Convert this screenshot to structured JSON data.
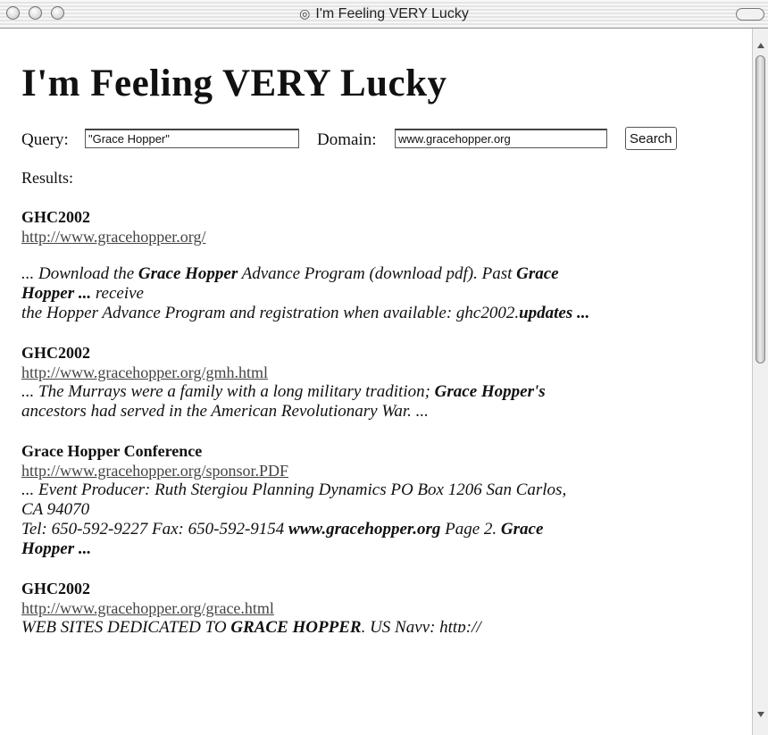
{
  "window": {
    "title": "I'm Feeling VERY Lucky",
    "title_icon": "compass-icon"
  },
  "page": {
    "heading": "I'm Feeling VERY Lucky",
    "query_label": "Query:",
    "query_value": "\"Grace Hopper\"",
    "domain_label": "Domain:",
    "domain_value": "www.gracehopper.org",
    "search_button": "Search",
    "results_label": "Results:"
  },
  "results": [
    {
      "title": "GHC2002",
      "url": "http://www.gracehopper.org/",
      "lines": [
        [
          [
            "",
            "... Download the "
          ],
          [
            "b",
            "Grace Hopper"
          ],
          [
            "",
            " Advance Program (download pdf). Past "
          ],
          [
            "b",
            "Grace"
          ]
        ],
        [
          [
            "b",
            "Hopper ..."
          ],
          [
            "",
            " receive"
          ]
        ],
        [
          [
            "",
            "the Hopper Advance Program and registration when available: ghc2002."
          ],
          [
            "b",
            "updates ..."
          ]
        ]
      ]
    },
    {
      "title": "GHC2002",
      "url": "http://www.gracehopper.org/gmh.html",
      "lines": [
        [
          [
            "",
            "... The Murrays were a family with a long military tradition; "
          ],
          [
            "b",
            "Grace Hopper's"
          ]
        ],
        [
          [
            "",
            "ancestors had served in the American Revolutionary War. ..."
          ]
        ]
      ]
    },
    {
      "title": "Grace Hopper Conference",
      "url": "http://www.gracehopper.org/sponsor.PDF",
      "lines": [
        [
          [
            "",
            "... Event Producer: Ruth Stergiou Planning Dynamics PO Box 1206 San Carlos,"
          ]
        ],
        [
          [
            "",
            "CA 94070"
          ]
        ],
        [
          [
            "",
            "Tel: 650-592-9227 Fax: 650-592-9154 "
          ],
          [
            "b",
            "www.gracehopper.org"
          ],
          [
            "",
            " Page 2. "
          ],
          [
            "b",
            "Grace"
          ]
        ],
        [
          [
            "b",
            "Hopper ..."
          ]
        ]
      ]
    },
    {
      "title": "GHC2002",
      "url": "http://www.gracehopper.org/grace.html",
      "lines": [
        [
          [
            "",
            "WEB SITES DEDICATED TO "
          ],
          [
            "b",
            "GRACE HOPPER"
          ],
          [
            "",
            ". US Navy: http://"
          ]
        ]
      ]
    }
  ]
}
